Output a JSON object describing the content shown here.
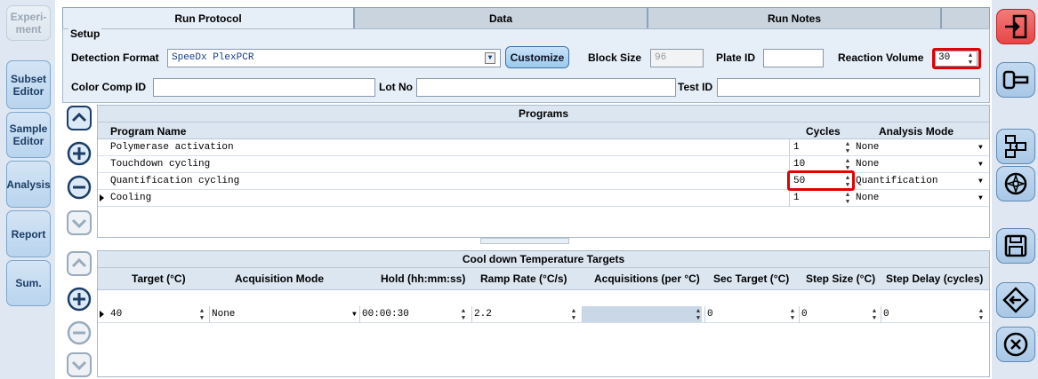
{
  "nav": {
    "experiment": "Experi-\nment",
    "subset_editor": "Subset\nEditor",
    "sample_editor": "Sample\nEditor",
    "analysis": "Analysis",
    "report": "Report",
    "sum": "Sum."
  },
  "tabs": [
    "Run Protocol",
    "Data",
    "Run Notes"
  ],
  "setup": {
    "legend": "Setup",
    "detection_format_label": "Detection Format",
    "detection_format_value": "SpeeDx PlexPCR",
    "customize_label": "Customize",
    "block_size_label": "Block Size",
    "block_size_value": "96",
    "plate_id_label": "Plate ID",
    "plate_id_value": "",
    "reaction_volume_label": "Reaction Volume",
    "reaction_volume_value": "30",
    "color_comp_label": "Color Comp ID",
    "color_comp_value": "",
    "lot_no_label": "Lot No",
    "lot_no_value": "",
    "test_id_label": "Test ID",
    "test_id_value": ""
  },
  "programs": {
    "title": "Programs",
    "headers": {
      "name": "Program Name",
      "cycles": "Cycles",
      "mode": "Analysis Mode"
    },
    "rows": [
      {
        "name": "Polymerase activation",
        "cycles": "1",
        "mode": "None"
      },
      {
        "name": "Touchdown cycling",
        "cycles": "10",
        "mode": "None"
      },
      {
        "name": "Quantification cycling",
        "cycles": "50",
        "mode": "Quantification"
      },
      {
        "name": "Cooling",
        "cycles": "1",
        "mode": "None"
      }
    ]
  },
  "cooldown": {
    "title": "Cool down Temperature Targets",
    "headers": {
      "target": "Target (°C)",
      "acq_mode": "Acquisition Mode",
      "hold": "Hold (hh:mm:ss)",
      "ramp": "Ramp Rate (°C/s)",
      "acq_per": "Acquisitions (per °C)",
      "sec_target": "Sec Target (°C)",
      "step_size": "Step Size (°C)",
      "step_delay": "Step Delay (cycles)"
    },
    "rows": [
      {
        "target": "40",
        "acq_mode": "None",
        "hold": "00:00:30",
        "ramp": "2.2",
        "acq_per": "",
        "sec_target": "0",
        "step_size": "0",
        "step_delay": "0"
      }
    ]
  }
}
